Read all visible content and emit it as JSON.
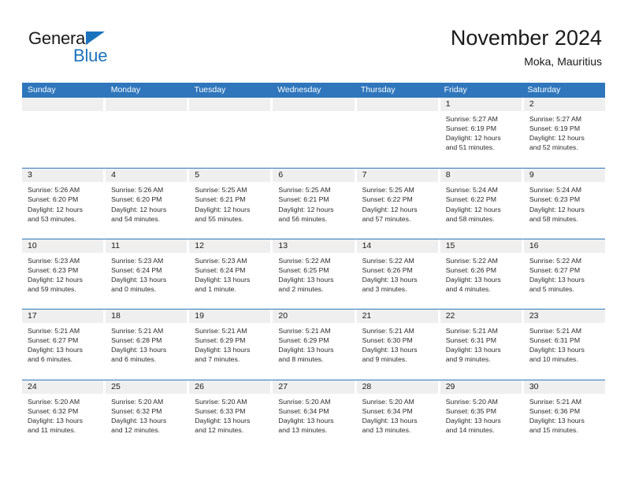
{
  "brand": {
    "name_part1": "General",
    "name_part2": "Blue",
    "accent_color": "#1b72bc"
  },
  "header": {
    "title": "November 2024",
    "subtitle": "Moka, Mauritius"
  },
  "theme": {
    "header_blue": "#2f76bc",
    "daynum_band": "#efefef",
    "text": "#222222"
  },
  "weekdays": [
    "Sunday",
    "Monday",
    "Tuesday",
    "Wednesday",
    "Thursday",
    "Friday",
    "Saturday"
  ],
  "weeks": [
    [
      {
        "day": "",
        "empty": true
      },
      {
        "day": "",
        "empty": true
      },
      {
        "day": "",
        "empty": true
      },
      {
        "day": "",
        "empty": true
      },
      {
        "day": "",
        "empty": true
      },
      {
        "day": "1",
        "sunrise": "Sunrise: 5:27 AM",
        "sunset": "Sunset: 6:19 PM",
        "daylight1": "Daylight: 12 hours",
        "daylight2": "and 51 minutes."
      },
      {
        "day": "2",
        "sunrise": "Sunrise: 5:27 AM",
        "sunset": "Sunset: 6:19 PM",
        "daylight1": "Daylight: 12 hours",
        "daylight2": "and 52 minutes."
      }
    ],
    [
      {
        "day": "3",
        "sunrise": "Sunrise: 5:26 AM",
        "sunset": "Sunset: 6:20 PM",
        "daylight1": "Daylight: 12 hours",
        "daylight2": "and 53 minutes."
      },
      {
        "day": "4",
        "sunrise": "Sunrise: 5:26 AM",
        "sunset": "Sunset: 6:20 PM",
        "daylight1": "Daylight: 12 hours",
        "daylight2": "and 54 minutes."
      },
      {
        "day": "5",
        "sunrise": "Sunrise: 5:25 AM",
        "sunset": "Sunset: 6:21 PM",
        "daylight1": "Daylight: 12 hours",
        "daylight2": "and 55 minutes."
      },
      {
        "day": "6",
        "sunrise": "Sunrise: 5:25 AM",
        "sunset": "Sunset: 6:21 PM",
        "daylight1": "Daylight: 12 hours",
        "daylight2": "and 56 minutes."
      },
      {
        "day": "7",
        "sunrise": "Sunrise: 5:25 AM",
        "sunset": "Sunset: 6:22 PM",
        "daylight1": "Daylight: 12 hours",
        "daylight2": "and 57 minutes."
      },
      {
        "day": "8",
        "sunrise": "Sunrise: 5:24 AM",
        "sunset": "Sunset: 6:22 PM",
        "daylight1": "Daylight: 12 hours",
        "daylight2": "and 58 minutes."
      },
      {
        "day": "9",
        "sunrise": "Sunrise: 5:24 AM",
        "sunset": "Sunset: 6:23 PM",
        "daylight1": "Daylight: 12 hours",
        "daylight2": "and 58 minutes."
      }
    ],
    [
      {
        "day": "10",
        "sunrise": "Sunrise: 5:23 AM",
        "sunset": "Sunset: 6:23 PM",
        "daylight1": "Daylight: 12 hours",
        "daylight2": "and 59 minutes."
      },
      {
        "day": "11",
        "sunrise": "Sunrise: 5:23 AM",
        "sunset": "Sunset: 6:24 PM",
        "daylight1": "Daylight: 13 hours",
        "daylight2": "and 0 minutes."
      },
      {
        "day": "12",
        "sunrise": "Sunrise: 5:23 AM",
        "sunset": "Sunset: 6:24 PM",
        "daylight1": "Daylight: 13 hours",
        "daylight2": "and 1 minute."
      },
      {
        "day": "13",
        "sunrise": "Sunrise: 5:22 AM",
        "sunset": "Sunset: 6:25 PM",
        "daylight1": "Daylight: 13 hours",
        "daylight2": "and 2 minutes."
      },
      {
        "day": "14",
        "sunrise": "Sunrise: 5:22 AM",
        "sunset": "Sunset: 6:26 PM",
        "daylight1": "Daylight: 13 hours",
        "daylight2": "and 3 minutes."
      },
      {
        "day": "15",
        "sunrise": "Sunrise: 5:22 AM",
        "sunset": "Sunset: 6:26 PM",
        "daylight1": "Daylight: 13 hours",
        "daylight2": "and 4 minutes."
      },
      {
        "day": "16",
        "sunrise": "Sunrise: 5:22 AM",
        "sunset": "Sunset: 6:27 PM",
        "daylight1": "Daylight: 13 hours",
        "daylight2": "and 5 minutes."
      }
    ],
    [
      {
        "day": "17",
        "sunrise": "Sunrise: 5:21 AM",
        "sunset": "Sunset: 6:27 PM",
        "daylight1": "Daylight: 13 hours",
        "daylight2": "and 6 minutes."
      },
      {
        "day": "18",
        "sunrise": "Sunrise: 5:21 AM",
        "sunset": "Sunset: 6:28 PM",
        "daylight1": "Daylight: 13 hours",
        "daylight2": "and 6 minutes."
      },
      {
        "day": "19",
        "sunrise": "Sunrise: 5:21 AM",
        "sunset": "Sunset: 6:29 PM",
        "daylight1": "Daylight: 13 hours",
        "daylight2": "and 7 minutes."
      },
      {
        "day": "20",
        "sunrise": "Sunrise: 5:21 AM",
        "sunset": "Sunset: 6:29 PM",
        "daylight1": "Daylight: 13 hours",
        "daylight2": "and 8 minutes."
      },
      {
        "day": "21",
        "sunrise": "Sunrise: 5:21 AM",
        "sunset": "Sunset: 6:30 PM",
        "daylight1": "Daylight: 13 hours",
        "daylight2": "and 9 minutes."
      },
      {
        "day": "22",
        "sunrise": "Sunrise: 5:21 AM",
        "sunset": "Sunset: 6:31 PM",
        "daylight1": "Daylight: 13 hours",
        "daylight2": "and 9 minutes."
      },
      {
        "day": "23",
        "sunrise": "Sunrise: 5:21 AM",
        "sunset": "Sunset: 6:31 PM",
        "daylight1": "Daylight: 13 hours",
        "daylight2": "and 10 minutes."
      }
    ],
    [
      {
        "day": "24",
        "sunrise": "Sunrise: 5:20 AM",
        "sunset": "Sunset: 6:32 PM",
        "daylight1": "Daylight: 13 hours",
        "daylight2": "and 11 minutes."
      },
      {
        "day": "25",
        "sunrise": "Sunrise: 5:20 AM",
        "sunset": "Sunset: 6:32 PM",
        "daylight1": "Daylight: 13 hours",
        "daylight2": "and 12 minutes."
      },
      {
        "day": "26",
        "sunrise": "Sunrise: 5:20 AM",
        "sunset": "Sunset: 6:33 PM",
        "daylight1": "Daylight: 13 hours",
        "daylight2": "and 12 minutes."
      },
      {
        "day": "27",
        "sunrise": "Sunrise: 5:20 AM",
        "sunset": "Sunset: 6:34 PM",
        "daylight1": "Daylight: 13 hours",
        "daylight2": "and 13 minutes."
      },
      {
        "day": "28",
        "sunrise": "Sunrise: 5:20 AM",
        "sunset": "Sunset: 6:34 PM",
        "daylight1": "Daylight: 13 hours",
        "daylight2": "and 13 minutes."
      },
      {
        "day": "29",
        "sunrise": "Sunrise: 5:20 AM",
        "sunset": "Sunset: 6:35 PM",
        "daylight1": "Daylight: 13 hours",
        "daylight2": "and 14 minutes."
      },
      {
        "day": "30",
        "sunrise": "Sunrise: 5:21 AM",
        "sunset": "Sunset: 6:36 PM",
        "daylight1": "Daylight: 13 hours",
        "daylight2": "and 15 minutes."
      }
    ]
  ]
}
